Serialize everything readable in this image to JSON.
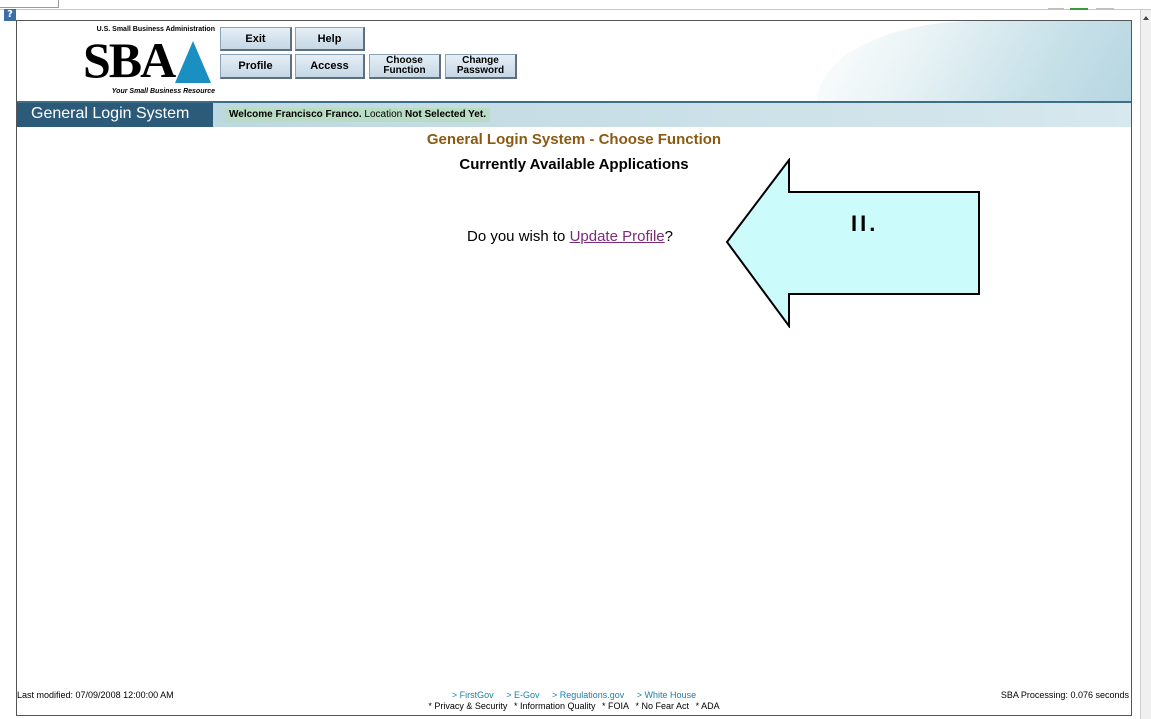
{
  "header": {
    "agency": "U.S. Small Business Administration",
    "logo_text": "SBA",
    "tagline": "Your Small Business Resource"
  },
  "toolbar": {
    "exit": "Exit",
    "help": "Help",
    "profile": "Profile",
    "access": "Access",
    "choose_function": "Choose\nFunction",
    "change_password": "Change\nPassword"
  },
  "nav": {
    "system_title": "General Login System",
    "welcome_prefix": "Welcome Francisco Franco.",
    "location_label": "Location",
    "location_value": "Not Selected Yet."
  },
  "main": {
    "title": "General Login System - Choose Function",
    "subtitle": "Currently Available Applications",
    "question_prefix": "Do you wish to",
    "update_profile_link": "Update Profile",
    "question_suffix": "?"
  },
  "callout": {
    "label": "II.",
    "fill_color": "#ccfbfb",
    "icon": "left-arrow-callout"
  },
  "footer": {
    "last_modified": "Last modified: 07/09/2008 12:00:00 AM",
    "processing": "SBA Processing:  0.076 seconds",
    "links": [
      "> FirstGov",
      "> E-Gov",
      "> Regulations.gov",
      "> White House"
    ],
    "links2": [
      "* Privacy & Security",
      "* Information Quality",
      "* FOIA",
      "* No Fear Act",
      "* ADA"
    ]
  },
  "colors": {
    "nav_title_bg": "#2c5b7a",
    "page_title": "#8a5a12",
    "link_visited": "#7a2a7a",
    "footer_link": "#1a7fa8"
  }
}
